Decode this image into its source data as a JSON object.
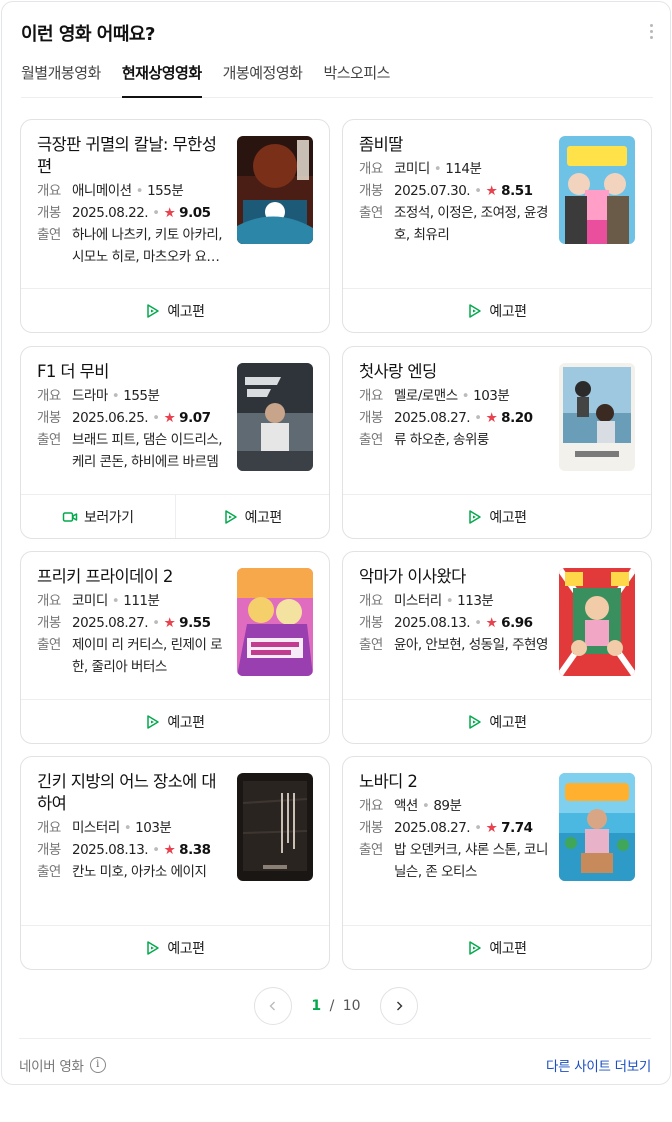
{
  "header": {
    "title": "이런 영화 어때요?"
  },
  "tabs": [
    {
      "label": "월별개봉영화",
      "active": false
    },
    {
      "label": "현재상영영화",
      "active": true
    },
    {
      "label": "개봉예정영화",
      "active": false
    },
    {
      "label": "박스오피스",
      "active": false
    }
  ],
  "labels": {
    "genre": "개요",
    "release": "개봉",
    "cast": "출연",
    "trailer": "예고편",
    "watch": "보러가기"
  },
  "movies": [
    {
      "title": "극장판 귀멸의 칼날: 무한성편",
      "genre": "애니메이션",
      "runtime": "155분",
      "release": "2025.08.22.",
      "rating": "9.05",
      "cast": "하나에 나츠키, 키토 아카리, 시모노 히로, 마츠오카 요시츠구",
      "poster": "poster-demon-slayer",
      "watch": false
    },
    {
      "title": "좀비딸",
      "genre": "코미디",
      "runtime": "114분",
      "release": "2025.07.30.",
      "rating": "8.51",
      "cast": "조정석, 이정은, 조여정, 윤경호, 최유리",
      "poster": "poster-zombie-daughter",
      "watch": false
    },
    {
      "title": "F1 더 무비",
      "genre": "드라마",
      "runtime": "155분",
      "release": "2025.06.25.",
      "rating": "9.07",
      "cast": "브래드 피트, 댐슨 이드리스, 케리 콘돈, 하비에르 바르뎀",
      "poster": "poster-f1",
      "watch": true
    },
    {
      "title": "첫사랑 엔딩",
      "genre": "멜로/로맨스",
      "runtime": "103분",
      "release": "2025.08.27.",
      "rating": "8.20",
      "cast": "류 하오춘, 송위룽",
      "poster": "poster-first-love",
      "watch": false
    },
    {
      "title": "프리키 프라이데이 2",
      "genre": "코미디",
      "runtime": "111분",
      "release": "2025.08.27.",
      "rating": "9.55",
      "cast": "제이미 리 커티스, 린제이 로한, 줄리아 버터스",
      "poster": "poster-freaky-friday",
      "watch": false
    },
    {
      "title": "악마가 이사왔다",
      "genre": "미스터리",
      "runtime": "113분",
      "release": "2025.08.13.",
      "rating": "6.96",
      "cast": "윤아, 안보현, 성동일, 주현영",
      "poster": "poster-devil-moved-in",
      "watch": false
    },
    {
      "title": "긴키 지방의 어느 장소에 대하여",
      "genre": "미스터리",
      "runtime": "103분",
      "release": "2025.08.13.",
      "rating": "8.38",
      "cast": "칸노 미호, 아카소 에이지",
      "poster": "poster-kinki",
      "watch": false
    },
    {
      "title": "노바디 2",
      "genre": "액션",
      "runtime": "89분",
      "release": "2025.08.27.",
      "rating": "7.74",
      "cast": "밥 오덴커크, 샤론 스톤, 코니 닐슨, 존 오티스",
      "poster": "poster-nobody-2",
      "watch": false
    }
  ],
  "pagination": {
    "current": "1",
    "separator": "/",
    "total": "10"
  },
  "footer": {
    "source": "네이버 영화",
    "more": "다른 사이트 더보기"
  },
  "colors": {
    "accent_green": "#03a94d",
    "star_red": "#e8424e",
    "link_blue": "#1b4fc2"
  }
}
